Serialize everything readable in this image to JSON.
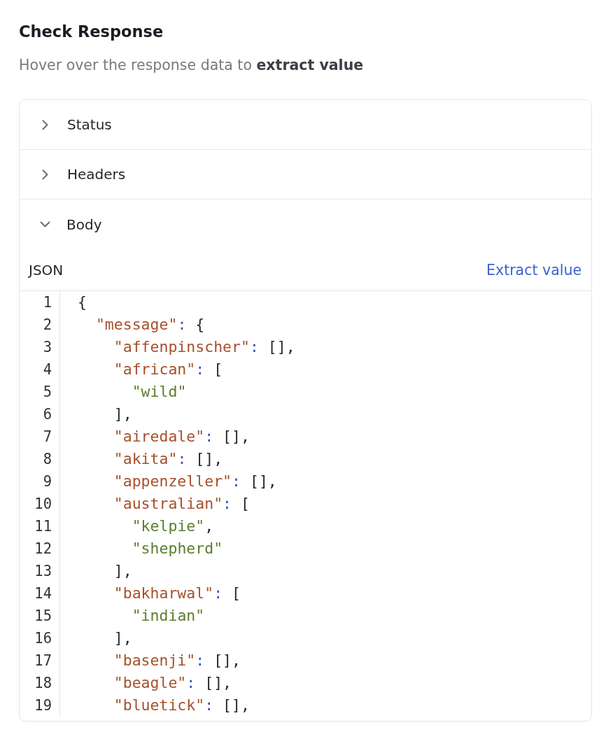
{
  "title": "Check Response",
  "instruction": "Hover over the response data to **extract value**",
  "sections": [
    {
      "label": "Status",
      "expanded": false
    },
    {
      "label": "Headers",
      "expanded": false
    },
    {
      "label": "Body",
      "expanded": true,
      "editor": {
        "format_label": "JSON",
        "action": "Extract value",
        "lines": [
          {
            "number": "1",
            "tokens": [
              {
                "kind": "punct",
                "text": "{"
              }
            ],
            "children": [
              {
                "number": "2",
                "tokens": [
                  {
                    "kind": "key",
                    "text": "\"message\""
                  },
                  {
                    "kind": "colon",
                    "text": ":"
                  },
                  {
                    "kind": "punct",
                    "text": "{"
                  }
                ],
                "children": [
                  {
                    "number": "3",
                    "tokens": [
                      {
                        "kind": "key",
                        "text": "\"affenpinscher\""
                      },
                      {
                        "kind": "colon",
                        "text": ":"
                      },
                      {
                        "kind": "punct",
                        "text": "[],"
                      }
                    ]
                  },
                  {
                    "number": "4",
                    "tokens": [
                      {
                        "kind": "key",
                        "text": "\"african\""
                      },
                      {
                        "kind": "colon",
                        "text": ":"
                      },
                      {
                        "kind": "punct",
                        "text": "["
                      }
                    ],
                    "children": [
                      {
                        "number": "5",
                        "tokens": [
                          {
                            "kind": "string",
                            "text": "\"wild\""
                          }
                        ]
                      }
                    ]
                  },
                  {
                    "number": "6",
                    "tokens": [
                      {
                        "kind": "punct",
                        "text": "],"
                      }
                    ]
                  },
                  {
                    "number": "7",
                    "tokens": [
                      {
                        "kind": "key",
                        "text": "\"airedale\""
                      },
                      {
                        "kind": "colon",
                        "text": ":"
                      },
                      {
                        "kind": "punct",
                        "text": "[],"
                      }
                    ]
                  },
                  {
                    "number": "8",
                    "tokens": [
                      {
                        "kind": "key",
                        "text": "\"akita\""
                      },
                      {
                        "kind": "colon",
                        "text": ":"
                      },
                      {
                        "kind": "punct",
                        "text": "[],"
                      }
                    ]
                  },
                  {
                    "number": "9",
                    "tokens": [
                      {
                        "kind": "key",
                        "text": "\"appenzeller\""
                      },
                      {
                        "kind": "colon",
                        "text": ":"
                      },
                      {
                        "kind": "punct",
                        "text": "[],"
                      }
                    ]
                  },
                  {
                    "number": "10",
                    "tokens": [
                      {
                        "kind": "key",
                        "text": "\"australian\""
                      },
                      {
                        "kind": "colon",
                        "text": ":"
                      },
                      {
                        "kind": "punct",
                        "text": "["
                      }
                    ],
                    "children": [
                      {
                        "number": "11",
                        "tokens": [
                          {
                            "kind": "string",
                            "text": "\"kelpie\""
                          },
                          {
                            "kind": "punct",
                            "text": ","
                          }
                        ]
                      },
                      {
                        "number": "12",
                        "tokens": [
                          {
                            "kind": "string",
                            "text": "\"shepherd\""
                          }
                        ]
                      }
                    ]
                  },
                  {
                    "number": "13",
                    "tokens": [
                      {
                        "kind": "punct",
                        "text": "],"
                      }
                    ]
                  },
                  {
                    "number": "14",
                    "tokens": [
                      {
                        "kind": "key",
                        "text": "\"bakharwal\""
                      },
                      {
                        "kind": "colon",
                        "text": ":"
                      },
                      {
                        "kind": "punct",
                        "text": "["
                      }
                    ],
                    "children": [
                      {
                        "number": "15",
                        "tokens": [
                          {
                            "kind": "string",
                            "text": "\"indian\""
                          }
                        ]
                      }
                    ]
                  },
                  {
                    "number": "16",
                    "tokens": [
                      {
                        "kind": "punct",
                        "text": "],"
                      }
                    ]
                  },
                  {
                    "number": "17",
                    "tokens": [
                      {
                        "kind": "key",
                        "text": "\"basenji\""
                      },
                      {
                        "kind": "colon",
                        "text": ":"
                      },
                      {
                        "kind": "punct",
                        "text": "[],"
                      }
                    ]
                  },
                  {
                    "number": "18",
                    "tokens": [
                      {
                        "kind": "key",
                        "text": "\"beagle\""
                      },
                      {
                        "kind": "colon",
                        "text": ":"
                      },
                      {
                        "kind": "punct",
                        "text": "[],"
                      }
                    ]
                  },
                  {
                    "number": "19",
                    "tokens": [
                      {
                        "kind": "key",
                        "text": "\"bluetick\""
                      },
                      {
                        "kind": "colon",
                        "text": ":"
                      },
                      {
                        "kind": "punct",
                        "text": "[],"
                      }
                    ]
                  }
                ]
              }
            ]
          }
        ]
      }
    }
  ]
}
